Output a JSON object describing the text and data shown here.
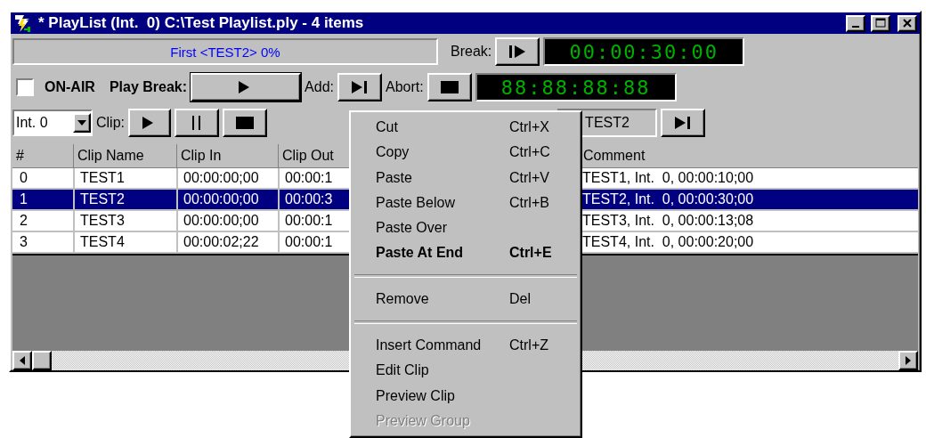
{
  "window": {
    "title": "* PlayList (Int.  0) C:\\Test Playlist.ply - 4 items"
  },
  "status": {
    "text": "First <TEST2> 0%"
  },
  "break": {
    "label": "Break:",
    "time": "00:00:30:00"
  },
  "on_air": {
    "label": "ON-AIR",
    "checked": false
  },
  "play_break": {
    "label": "Play Break:"
  },
  "add": {
    "label": "Add:"
  },
  "abort": {
    "label": "Abort:",
    "time": "88:88:88:88"
  },
  "channel_select": {
    "value": "Int. 0"
  },
  "clip": {
    "label": "Clip:"
  },
  "cue_field": {
    "value": "TEST2"
  },
  "table": {
    "columns": [
      "#",
      "Clip Name",
      "Clip In",
      "Clip Out",
      "Comment"
    ],
    "rows": [
      {
        "cells": [
          "0",
          "TEST1",
          "00:00:00;00",
          "00:00:1",
          "TEST1, Int.  0, 00:00:10;00"
        ],
        "selected": false
      },
      {
        "cells": [
          "1",
          "TEST2",
          "00:00:00;00",
          "00:00:3",
          "TEST2, Int.  0, 00:00:30;00"
        ],
        "selected": true
      },
      {
        "cells": [
          "2",
          "TEST3",
          "00:00:00;00",
          "00:00:1",
          "TEST3, Int.  0, 00:00:13;08"
        ],
        "selected": false
      },
      {
        "cells": [
          "3",
          "TEST4",
          "00:00:02;22",
          "00:00:1",
          "TEST4, Int.  0, 00:00:20;00"
        ],
        "selected": false
      }
    ]
  },
  "context_menu": {
    "items": [
      {
        "kind": "item",
        "label": "Cut",
        "shortcut": "Ctrl+X",
        "bold": false,
        "disabled": false
      },
      {
        "kind": "item",
        "label": "Copy",
        "shortcut": "Ctrl+C",
        "bold": false,
        "disabled": false
      },
      {
        "kind": "item",
        "label": "Paste",
        "shortcut": "Ctrl+V",
        "bold": false,
        "disabled": false
      },
      {
        "kind": "item",
        "label": "Paste Below",
        "shortcut": "Ctrl+B",
        "bold": false,
        "disabled": false
      },
      {
        "kind": "item",
        "label": "Paste Over",
        "bold": false,
        "disabled": false
      },
      {
        "kind": "item",
        "label": "Paste At End",
        "shortcut": "Ctrl+E",
        "bold": true,
        "disabled": false
      },
      {
        "kind": "separator"
      },
      {
        "kind": "item",
        "label": "Remove",
        "shortcut": "Del",
        "bold": false,
        "disabled": false
      },
      {
        "kind": "separator"
      },
      {
        "kind": "item",
        "label": "Insert Command",
        "shortcut": "Ctrl+Z",
        "bold": false,
        "disabled": false
      },
      {
        "kind": "item",
        "label": "Edit Clip",
        "bold": false,
        "disabled": false
      },
      {
        "kind": "item",
        "label": "Preview Clip",
        "bold": false,
        "disabled": false
      },
      {
        "kind": "item",
        "label": "Preview Group",
        "bold": false,
        "disabled": true
      }
    ]
  }
}
